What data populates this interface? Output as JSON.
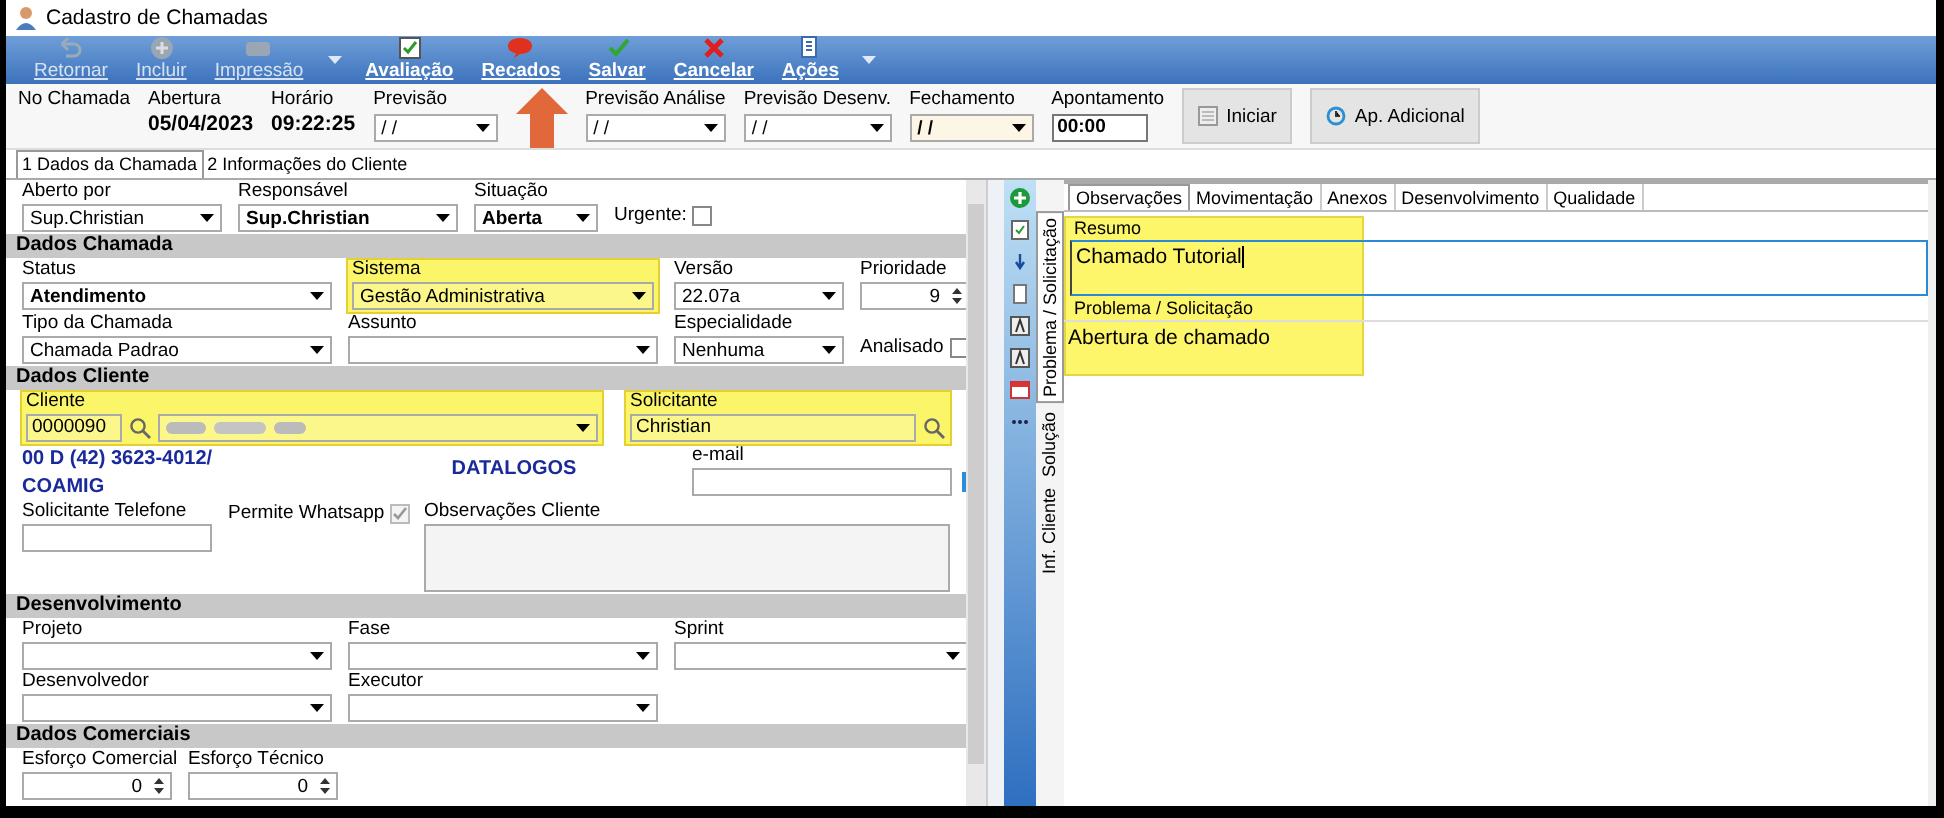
{
  "window": {
    "title": "Cadastro de Chamadas"
  },
  "toolbar": [
    {
      "label": "Retornar",
      "kind": "undo",
      "disabled": true,
      "menu": false
    },
    {
      "label": "Incluir",
      "kind": "add",
      "disabled": true,
      "menu": false
    },
    {
      "label": "Impressão",
      "kind": "print",
      "disabled": true,
      "menu": true
    },
    {
      "label": "Avaliação",
      "kind": "rate",
      "disabled": false,
      "menu": false
    },
    {
      "label": "Recados",
      "kind": "message",
      "disabled": false,
      "menu": false
    },
    {
      "label": "Salvar",
      "kind": "save",
      "disabled": false,
      "menu": false
    },
    {
      "label": "Cancelar",
      "kind": "cancel",
      "disabled": false,
      "menu": false
    },
    {
      "label": "Ações",
      "kind": "actions",
      "disabled": false,
      "menu": true
    }
  ],
  "header": [
    {
      "label": "No Chamada",
      "kind": "text"
    },
    {
      "label": "Abertura",
      "kind": "text",
      "value": "05/04/2023"
    },
    {
      "label": "Horário",
      "kind": "text",
      "value": "09:22:25"
    },
    {
      "label": "Previsão",
      "kind": "date",
      "value": "/ /",
      "focused": false
    },
    {
      "label": "Previsão Análise",
      "kind": "date",
      "value": "/ /",
      "focused": false
    },
    {
      "label": "Previsão Desenv.",
      "kind": "date",
      "value": "/ /",
      "focused": false
    },
    {
      "label": "Fechamento",
      "kind": "date",
      "value": "/ /",
      "focused": true
    },
    {
      "label": "Apontamento",
      "kind": "time",
      "value": "00:00"
    }
  ],
  "header_buttons": [
    {
      "label": "Iniciar",
      "kind": "start"
    },
    {
      "label": "Ap. Adicional",
      "kind": "clock"
    }
  ],
  "annotation": {
    "kind": "arrow"
  },
  "tabs": [
    {
      "label": "1 Dados da Chamada",
      "selected": true
    },
    {
      "label": "2 Informações do Cliente",
      "selected": false
    }
  ],
  "form": [
    {
      "kind": "row",
      "fields": [
        {
          "label": "Aberto por",
          "kind": "select",
          "value": "Sup.Christian",
          "bold": false
        },
        {
          "label": "Responsável",
          "kind": "select",
          "value": "Sup.Christian",
          "bold": true
        },
        {
          "label": "Situação",
          "kind": "select",
          "value": "Aberta",
          "bold": true
        },
        {
          "label": "Urgente:",
          "kind": "check",
          "checked": false,
          "disabled": false
        }
      ]
    },
    {
      "kind": "section",
      "title": "Dados Chamada"
    },
    {
      "kind": "row",
      "fields": [
        {
          "label": "Status",
          "kind": "select",
          "value": "Atendimento",
          "bold": true
        },
        {
          "label": "Sistema",
          "kind": "select",
          "value": "Gestão Administrativa",
          "bold": false,
          "highlighted": true
        },
        {
          "label": "Versão",
          "kind": "select",
          "value": "22.07a",
          "bold": false
        },
        {
          "label": "Prioridade",
          "kind": "spin",
          "value": "9"
        }
      ]
    },
    {
      "kind": "row",
      "fields": [
        {
          "label": "Tipo da Chamada",
          "kind": "select",
          "value": "Chamada Padrao",
          "bold": false
        },
        {
          "label": "Assunto",
          "kind": "select"
        },
        {
          "label": "Especialidade",
          "kind": "select",
          "value": "Nenhuma",
          "bold": false
        },
        {
          "label": "Analisado",
          "kind": "check",
          "checked": false,
          "disabled": false
        }
      ]
    },
    {
      "kind": "section",
      "title": "Dados Cliente"
    },
    {
      "kind": "row",
      "fields": [
        {
          "label": "Cliente",
          "kind": "lookup",
          "code": "0000090",
          "blurred": true,
          "highlighted": true
        },
        {
          "label": "Solicitante",
          "kind": "lookup",
          "value": "Christian",
          "highlighted": true
        }
      ]
    },
    {
      "kind": "row",
      "fields": [
        {
          "kind": "info",
          "lines": [
            "00 D  (42) 3623-4012/",
            "COAMIG"
          ]
        },
        {
          "kind": "info",
          "lines": [
            "DATALOGOS"
          ]
        },
        {
          "label": "e-mail",
          "kind": "email"
        }
      ]
    },
    {
      "kind": "row",
      "fields": [
        {
          "label": "Solicitante Telefone",
          "kind": "input"
        },
        {
          "label": "Permite Whatsapp",
          "kind": "check",
          "checked": true,
          "disabled": true
        },
        {
          "label": "Observações Cliente",
          "kind": "textarea"
        }
      ]
    },
    {
      "kind": "section",
      "title": "Desenvolvimento"
    },
    {
      "kind": "row",
      "fields": [
        {
          "label": "Projeto",
          "kind": "select"
        },
        {
          "label": "Fase",
          "kind": "select"
        },
        {
          "label": "Sprint",
          "kind": "select"
        }
      ]
    },
    {
      "kind": "row",
      "fields": [
        {
          "label": "Desenvolvedor",
          "kind": "select"
        },
        {
          "label": "Executor",
          "kind": "select"
        }
      ]
    },
    {
      "kind": "section",
      "title": "Dados Comerciais"
    },
    {
      "kind": "row",
      "fields": [
        {
          "label": "Esforço Comercial",
          "kind": "spin",
          "value": "0"
        },
        {
          "label": "Esforço Técnico",
          "kind": "spin",
          "value": "0"
        }
      ]
    }
  ],
  "vertical_tabs": [
    {
      "label": "Problema / Solicitação",
      "selected": true
    },
    {
      "label": "Solução",
      "selected": false
    },
    {
      "label": "Inf. Cliente",
      "selected": false
    }
  ],
  "note_tabs": [
    {
      "label": "Observações",
      "selected": true
    },
    {
      "label": "Movimentação",
      "selected": false
    },
    {
      "label": "Anexos",
      "selected": false
    },
    {
      "label": "Desenvolvimento",
      "selected": false
    },
    {
      "label": "Qualidade",
      "selected": false
    }
  ],
  "notes": {
    "highlighted": true,
    "summary": {
      "label": "Resumo",
      "value": "Chamado Tutorial"
    },
    "problem": {
      "label": "Problema / Solicitação",
      "value": "Abertura de chamado"
    }
  }
}
